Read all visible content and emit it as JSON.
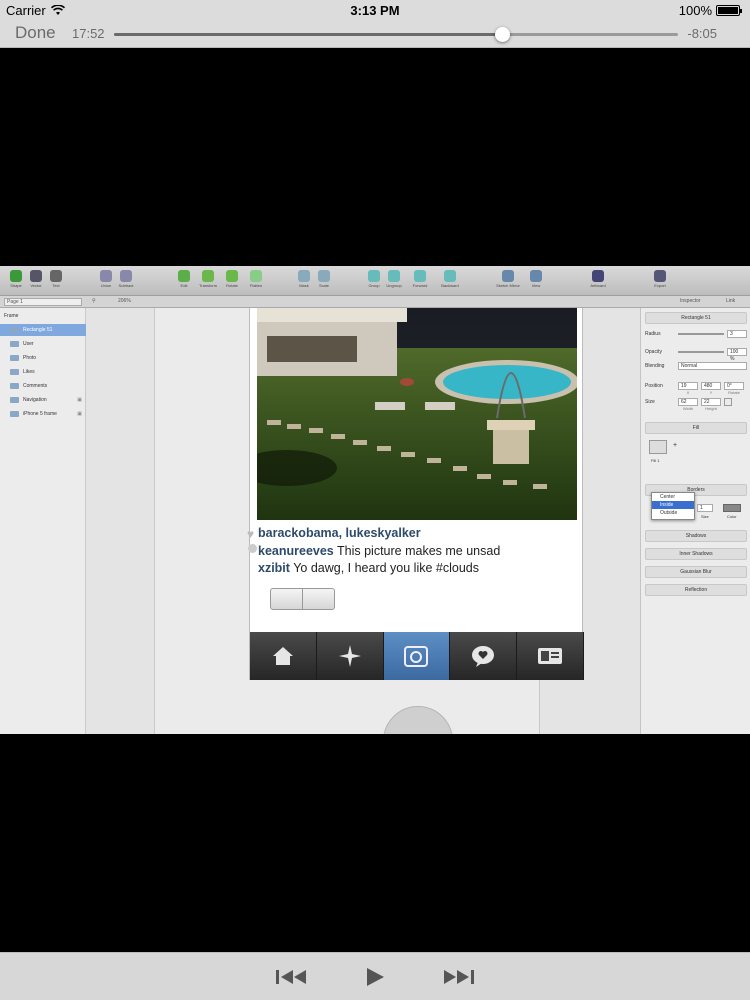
{
  "status_bar": {
    "carrier": "Carrier",
    "time": "3:13 PM",
    "battery": "100%"
  },
  "player": {
    "done_label": "Done",
    "elapsed": "17:52",
    "remaining": "-8:05",
    "progress": 0.688
  },
  "sketch": {
    "toolbar": [
      "Shape",
      "Vector",
      "Text",
      "Union",
      "Subtract",
      "Edit",
      "Transform",
      "Rotate",
      "Flatten",
      "Mask",
      "Scale",
      "Group",
      "Ungroup",
      "Forward",
      "Backward",
      "Sketch Mirror",
      "View",
      "Artboard",
      "Export"
    ],
    "page_select": "Page 1",
    "zoom": "206%",
    "tabs": [
      "Inspector",
      "Link"
    ],
    "layers": [
      {
        "label": "Frame",
        "indent": 0,
        "selected": false,
        "lock": false
      },
      {
        "label": "Rectangle 51",
        "indent": 1,
        "selected": true,
        "lock": false
      },
      {
        "label": "User",
        "indent": 1,
        "selected": false,
        "lock": false
      },
      {
        "label": "Photo",
        "indent": 1,
        "selected": false,
        "lock": false
      },
      {
        "label": "Likes",
        "indent": 1,
        "selected": false,
        "lock": false
      },
      {
        "label": "Comments",
        "indent": 1,
        "selected": false,
        "lock": false
      },
      {
        "label": "Navigation",
        "indent": 1,
        "selected": false,
        "lock": true
      },
      {
        "label": "iPhone 5 frame",
        "indent": 1,
        "selected": false,
        "lock": true
      }
    ],
    "inspector": {
      "title": "Rectangle 51",
      "radius_label": "Radius",
      "radius": "3",
      "opacity_label": "Opacity",
      "opacity": "100 %",
      "blending_label": "Blending",
      "blending": "Normal",
      "position_label": "Position",
      "pos_x": "19",
      "pos_y": "480",
      "rotate": "0°",
      "x_label": "X",
      "y_label": "Y",
      "rotate_label": "Rotate",
      "size_label": "Size",
      "width": "62",
      "height": "22",
      "width_label": "Width",
      "height_label": "Height",
      "fill_label": "Fill",
      "fill1_label": "Fill 1",
      "borders_label": "Borders",
      "border_options": [
        "Center",
        "Inside",
        "Outside"
      ],
      "border_selected": "Inside",
      "border_size": "1",
      "size_col": "Size",
      "color_col": "Color",
      "shadows_label": "Shadows",
      "inner_shadows_label": "Inner Shadows",
      "blur_label": "Gaussian Blur",
      "reflection_label": "Reflection"
    },
    "feed": {
      "likes": "barackobama, lukeskyalker",
      "comments": [
        {
          "user": "keanureeves",
          "text": "This picture makes me unsad"
        },
        {
          "user": "xzibit",
          "text": "Yo dawg, I heard you like #clouds"
        }
      ],
      "tab_icons": [
        "home-icon",
        "explore-icon",
        "camera-icon",
        "activity-icon",
        "profile-icon"
      ],
      "selected_tab": 2
    }
  }
}
